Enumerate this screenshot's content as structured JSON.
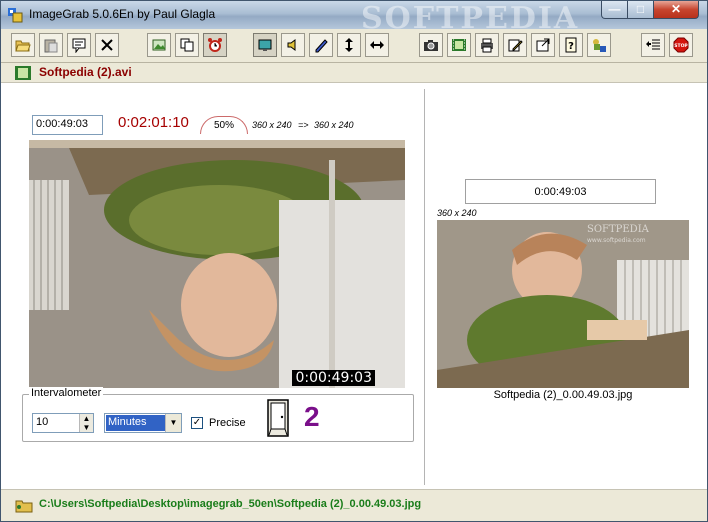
{
  "window": {
    "title": "ImageGrab 5.0.6En by Paul Glagla",
    "watermark": "SOFTPEDIA",
    "minimize_glyph": "—",
    "maximize_glyph": "□",
    "close_glyph": "✕"
  },
  "toolbar": {
    "buttons": [
      {
        "name": "open-video-button",
        "icon": "open-folder-icon"
      },
      {
        "name": "paste-button",
        "icon": "clipboard-icon"
      },
      {
        "name": "comment-button",
        "icon": "comment-icon"
      },
      {
        "name": "close-video-button",
        "icon": "close-x-icon"
      },
      {
        "name": "insert-image-button",
        "icon": "image-icon"
      },
      {
        "name": "copy-button",
        "icon": "copy-icon"
      },
      {
        "name": "alarm-button",
        "icon": "alarm-clock-icon"
      },
      {
        "name": "display-button",
        "icon": "monitor-icon"
      },
      {
        "name": "sound-button",
        "icon": "speaker-icon"
      },
      {
        "name": "draw-button",
        "icon": "pen-icon"
      },
      {
        "name": "flip-vertical-button",
        "icon": "flip-vertical-icon"
      },
      {
        "name": "flip-horizontal-button",
        "icon": "flip-horizontal-icon"
      },
      {
        "name": "capture-button",
        "icon": "camera-icon"
      },
      {
        "name": "film-button",
        "icon": "film-icon"
      },
      {
        "name": "print-button",
        "icon": "printer-icon"
      },
      {
        "name": "edit-button",
        "icon": "pencil-icon"
      },
      {
        "name": "settings-button",
        "icon": "settings-icon"
      },
      {
        "name": "help-button",
        "icon": "help-icon"
      },
      {
        "name": "about-button",
        "icon": "puzzle-icon"
      },
      {
        "name": "options-button",
        "icon": "list-options-icon"
      },
      {
        "name": "stop-button",
        "icon": "stop-icon"
      }
    ]
  },
  "file": {
    "name": "Softpedia (2).avi"
  },
  "player": {
    "position": "0:00:49:03",
    "duration": "0:02:01:10",
    "zoom": "50%",
    "source_resolution": "360 x 240",
    "arrow": "=>",
    "output_resolution": "360 x 240",
    "timecode_overlay": "0:00:49:03"
  },
  "intervalometer": {
    "legend": "Intervalometer",
    "value": "10",
    "unit": "Minutes",
    "precise_label": "Precise",
    "precise_checked": true,
    "count": "2"
  },
  "capture": {
    "time": "0:00:49:03",
    "resolution": "360 x 240",
    "filename": "Softpedia (2)_0.00.49.03.jpg",
    "watermark": "SOFTPEDIA",
    "watermark_url": "www.softpedia.com"
  },
  "status": {
    "path": "C:\\Users\\Softpedia\\Desktop\\imagegrab_50en\\Softpedia (2)_0.00.49.03.jpg"
  },
  "colors": {
    "duration": "#a60000",
    "count": "#7a0f8a",
    "path": "#1a7d1a",
    "filename": "#8b0000"
  }
}
